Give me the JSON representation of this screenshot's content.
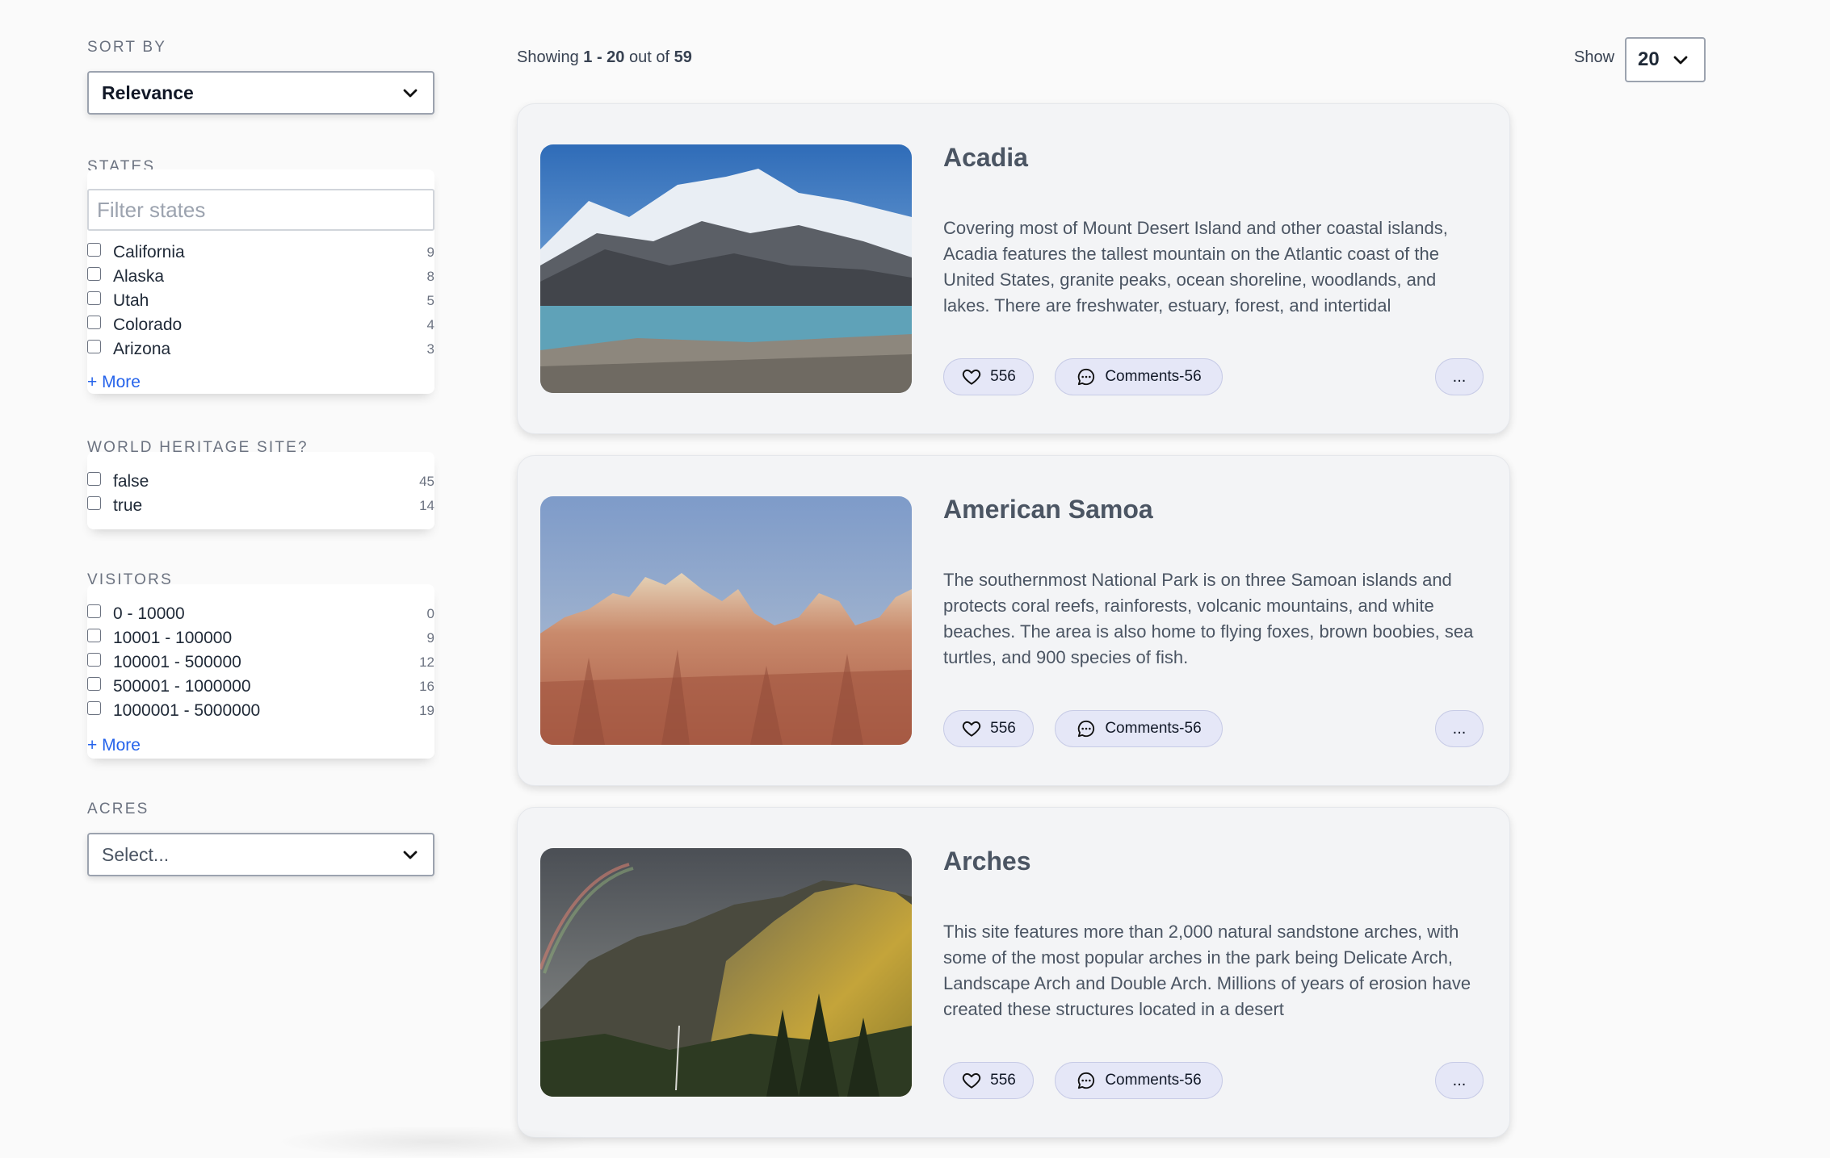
{
  "sort": {
    "label": "SORT BY",
    "value": "Relevance"
  },
  "states": {
    "label": "STATES",
    "filter_placeholder": "Filter states",
    "options": [
      {
        "label": "California",
        "count": "9"
      },
      {
        "label": "Alaska",
        "count": "8"
      },
      {
        "label": "Utah",
        "count": "5"
      },
      {
        "label": "Colorado",
        "count": "4"
      },
      {
        "label": "Arizona",
        "count": "3"
      }
    ],
    "more": "+ More"
  },
  "heritage": {
    "label": "WORLD HERITAGE SITE?",
    "options": [
      {
        "label": "false",
        "count": "45"
      },
      {
        "label": "true",
        "count": "14"
      }
    ]
  },
  "visitors": {
    "label": "VISITORS",
    "options": [
      {
        "label": "0 - 10000",
        "count": "0"
      },
      {
        "label": "10001 - 100000",
        "count": "9"
      },
      {
        "label": "100001 - 500000",
        "count": "12"
      },
      {
        "label": "500001 - 1000000",
        "count": "16"
      },
      {
        "label": "1000001 - 5000000",
        "count": "19"
      }
    ],
    "more": "+ More"
  },
  "acres": {
    "label": "ACRES",
    "placeholder": "Select..."
  },
  "results": {
    "prefix": "Showing",
    "range": "1 - 20",
    "middle": "out of",
    "total": "59",
    "show_label": "Show",
    "show_value": "20"
  },
  "cards": [
    {
      "title": "Acadia",
      "description": "Covering most of Mount Desert Island and other coastal islands, Acadia features the tallest mountain on the Atlantic coast of the United States, granite peaks, ocean shoreline, woodlands, and lakes. There are freshwater, estuary, forest, and intertidal",
      "likes": "556",
      "comments": "Comments-56",
      "more": "..."
    },
    {
      "title": "American Samoa",
      "description": "The southernmost National Park is on three Samoan islands and protects coral reefs, rainforests, volcanic mountains, and white beaches. The area is also home to flying foxes, brown boobies, sea turtles, and 900 species of fish.",
      "likes": "556",
      "comments": "Comments-56",
      "more": "..."
    },
    {
      "title": "Arches",
      "description": "This site features more than 2,000 natural sandstone arches, with some of the most popular arches in the park being Delicate Arch, Landscape Arch and Double Arch. Millions of years of erosion have created these structures located in a desert",
      "likes": "556",
      "comments": "Comments-56",
      "more": "..."
    }
  ]
}
